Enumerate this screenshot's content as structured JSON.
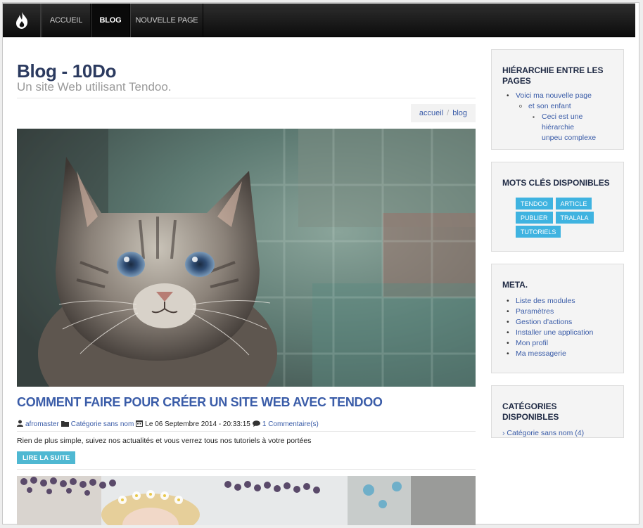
{
  "navbar": {
    "logo_icon": "flame-logo-icon",
    "items": [
      {
        "label": "ACCUEIL",
        "active": false
      },
      {
        "label": "BLOG",
        "active": true
      },
      {
        "label": "NOUVELLE PAGE",
        "active": false
      }
    ]
  },
  "header": {
    "title": "Blog - 10Do",
    "subtitle": "Un site Web utilisant Tendoo."
  },
  "breadcrumb": {
    "items": [
      "accueil",
      "blog"
    ],
    "separator": "/"
  },
  "post": {
    "image": "kitten-photo",
    "title": "COMMENT FAIRE POUR CRÉER UN SITE WEB AVEC TENDOO",
    "author": "afromaster",
    "category": "Catégorie sans nom",
    "date": "Le 06 Septembre 2014 - 20:33:15",
    "comments": "1 Commentaire(s)",
    "excerpt": "Rien de plus simple, suivez nos actualités et vous verrez tous nos tutoriels à votre portées",
    "read_more": "LIRE LA SUITE"
  },
  "next_post": {
    "image": "flower-crown-photo"
  },
  "sidebar": {
    "hierarchy": {
      "title": "HIÉRARCHIE ENTRE LES PAGES",
      "l1": "Voici ma nouvelle page",
      "l2": "et son enfant",
      "l3a": "Ceci est une hiérarchie",
      "l3b": "unpeu complexe"
    },
    "tags": {
      "title": "MOTS CLÉS DISPONIBLES",
      "items": [
        "TENDOO",
        "ARTICLE",
        "PUBLIER",
        "TRALALA",
        "TUTORIELS"
      ]
    },
    "meta": {
      "title": "META.",
      "items": [
        "Liste des modules",
        "Paramètres",
        "Gestion d'actions",
        "Installer une application",
        "Mon profil",
        "Ma messagerie"
      ]
    },
    "categories": {
      "title": "CATÉGORIES DISPONIBLES",
      "items": [
        "Catégorie sans nom (4)"
      ]
    }
  },
  "colors": {
    "navbar": "#111111",
    "title": "#2b3a5f",
    "link": "#3a5ca8",
    "tag": "#3fb3e0",
    "read_more": "#4fb8d2"
  }
}
